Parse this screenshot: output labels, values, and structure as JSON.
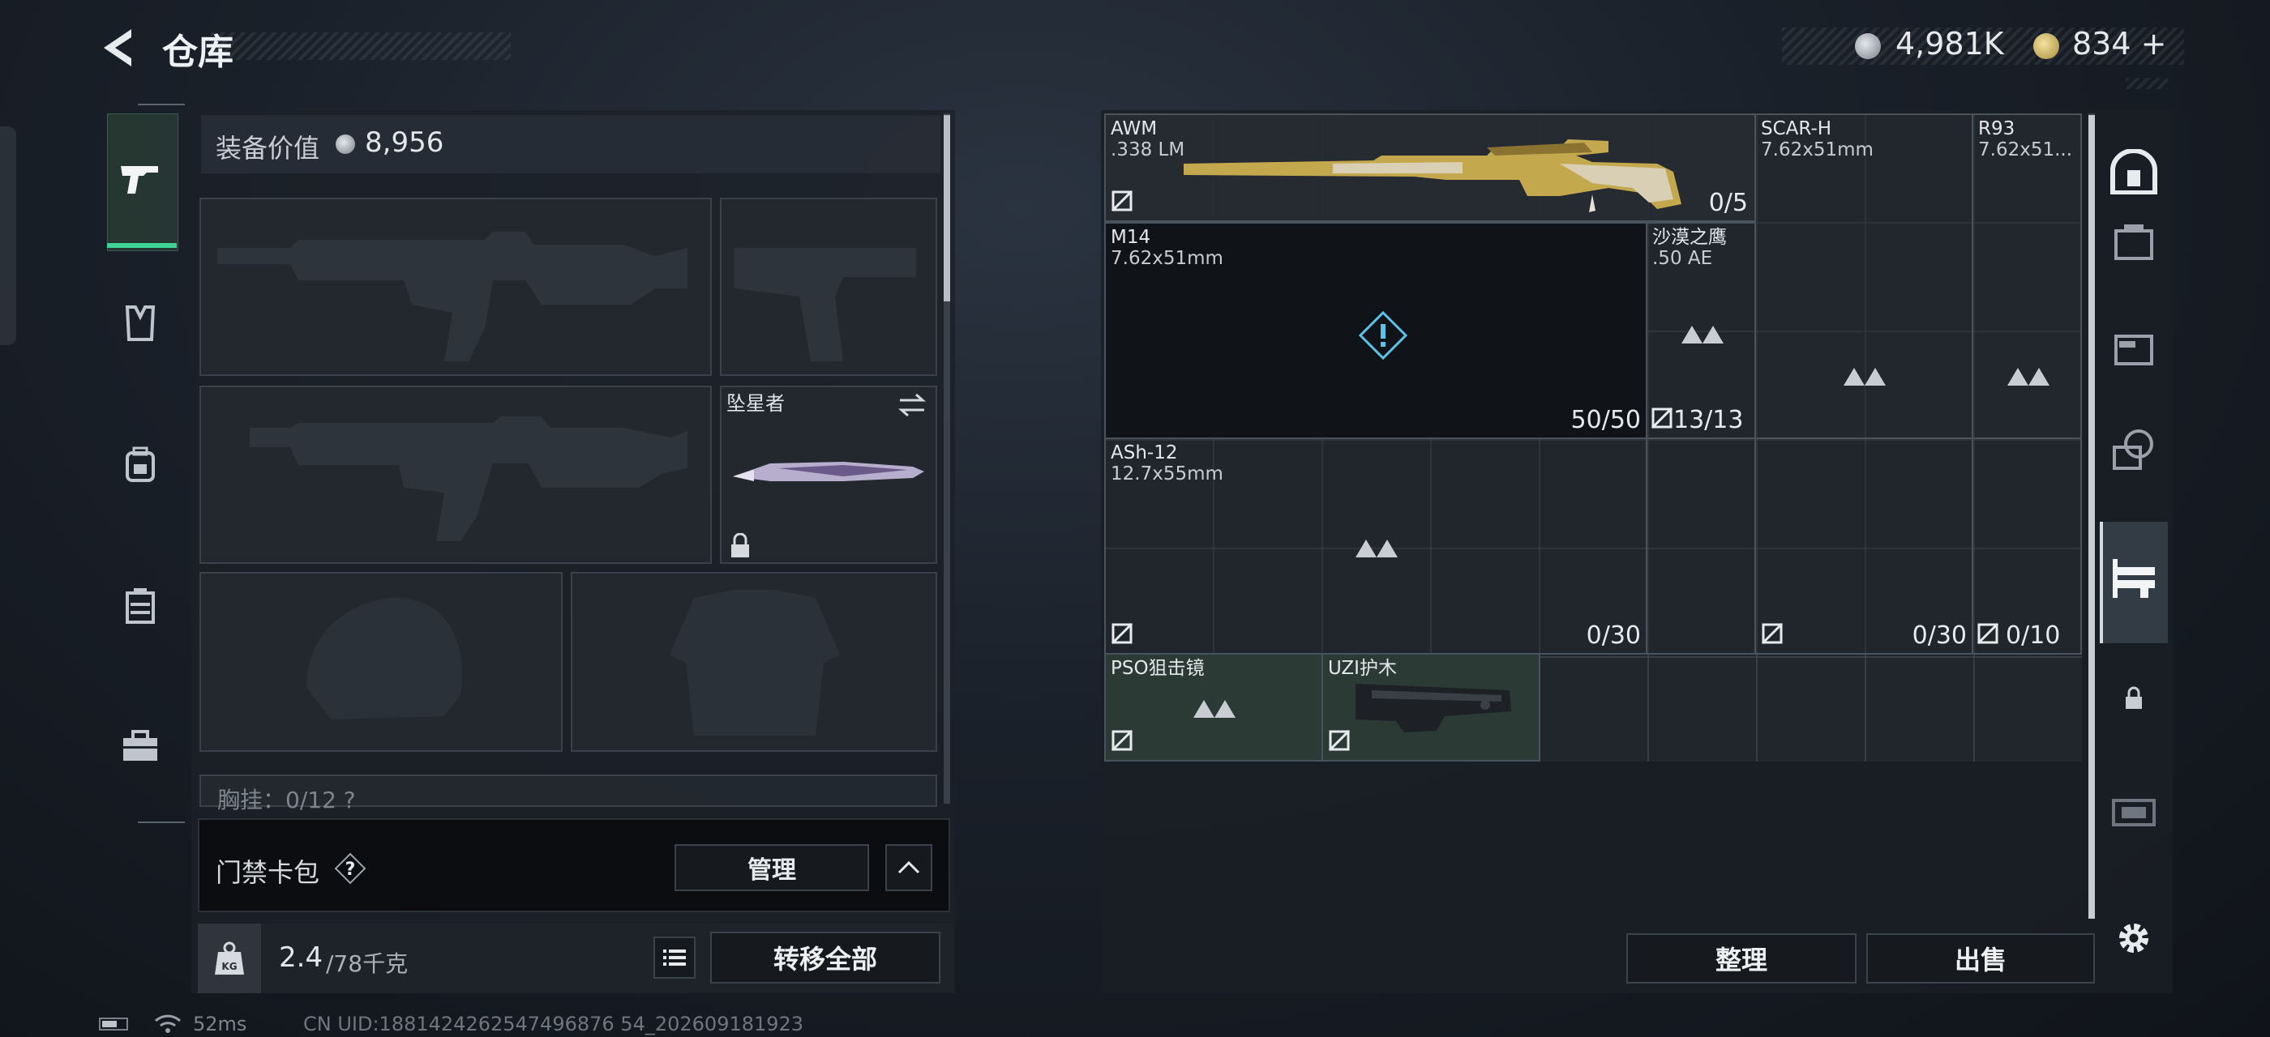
{
  "header": {
    "title": "仓库"
  },
  "currency": {
    "coins": "4,981K",
    "premium": "834",
    "add_label": "+"
  },
  "left_rail": {
    "items": [
      "pistol-tab",
      "gear-tab",
      "backpack-tab",
      "rig-tab",
      "toolbox-tab"
    ]
  },
  "loadout": {
    "value_label": "装备价值",
    "value": "8,956",
    "melee_name": "坠星者",
    "rig_text": "胸挂：0/12  ?"
  },
  "keycard": {
    "label": "门禁卡包",
    "help": "?",
    "manage": "管理"
  },
  "weight": {
    "current": "2.4",
    "max": "/78千克",
    "kg": "KG",
    "transfer": "转移全部"
  },
  "storage": {
    "items": [
      {
        "id": "awm",
        "name": "AWM",
        "caliber": ".338 LM",
        "count": "0/5"
      },
      {
        "id": "scarh",
        "name": "SCAR-H",
        "caliber": "7.62x51mm",
        "count": "0/30"
      },
      {
        "id": "r93",
        "name": "R93",
        "caliber": "7.62x51...",
        "count": "0/10"
      },
      {
        "id": "m14",
        "name": "M14",
        "caliber": "7.62x51mm",
        "count": "50/50"
      },
      {
        "id": "deagle",
        "name": "沙漠之鹰",
        "caliber": ".50 AE",
        "count": "13/13"
      },
      {
        "id": "ash12",
        "name": "ASh-12",
        "caliber": "12.7x55mm",
        "count": "0/30"
      },
      {
        "id": "pso",
        "name": "PSO狙击镜",
        "caliber": "",
        "count": ""
      },
      {
        "id": "uzi",
        "name": "UZI护木",
        "caliber": "",
        "count": ""
      }
    ],
    "sort": "整理",
    "sell": "出售"
  },
  "status": {
    "ping": "52ms",
    "uid": "CN UID:1881424262547496876 54_202609181923"
  },
  "colors": {
    "accent": "#3fd39a",
    "item_green": "#2b3a34",
    "dark_slot": "#101317"
  }
}
